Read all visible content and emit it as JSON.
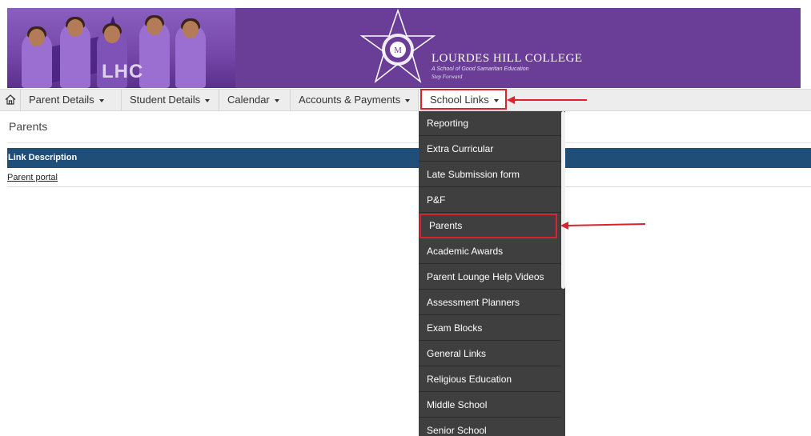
{
  "header": {
    "photo_logo_text": "LHC",
    "school_name": "LOURDES HILL COLLEGE",
    "school_tagline": "A School of Good Samaritan Education",
    "school_motto": "Step Forward",
    "colors": {
      "banner": "#6a3d97",
      "nav_bar": "#ededed",
      "menu_bg": "#3f3f3f",
      "table_header": "#1f4e79",
      "highlight": "#d9232d"
    }
  },
  "nav": {
    "home_icon": "home-icon",
    "items": [
      {
        "label": "Parent Details"
      },
      {
        "label": "Student Details"
      },
      {
        "label": "Calendar"
      },
      {
        "label": "Accounts & Payments"
      },
      {
        "label": "School Links",
        "active": true
      }
    ]
  },
  "page": {
    "title": "Parents",
    "table": {
      "column_header": "Link Description",
      "rows": [
        {
          "link": "Parent portal"
        }
      ]
    }
  },
  "dropdown": {
    "items": [
      {
        "label": "Reporting"
      },
      {
        "label": "Extra Curricular"
      },
      {
        "label": "Late Submission form"
      },
      {
        "label": "P&F"
      },
      {
        "label": "Parents",
        "highlighted": true
      },
      {
        "label": "Academic Awards"
      },
      {
        "label": "Parent Lounge Help Videos"
      },
      {
        "label": "Assessment Planners"
      },
      {
        "label": "Exam Blocks"
      },
      {
        "label": "General Links"
      },
      {
        "label": "Religious Education"
      },
      {
        "label": "Middle School"
      },
      {
        "label": "Senior School"
      }
    ]
  }
}
